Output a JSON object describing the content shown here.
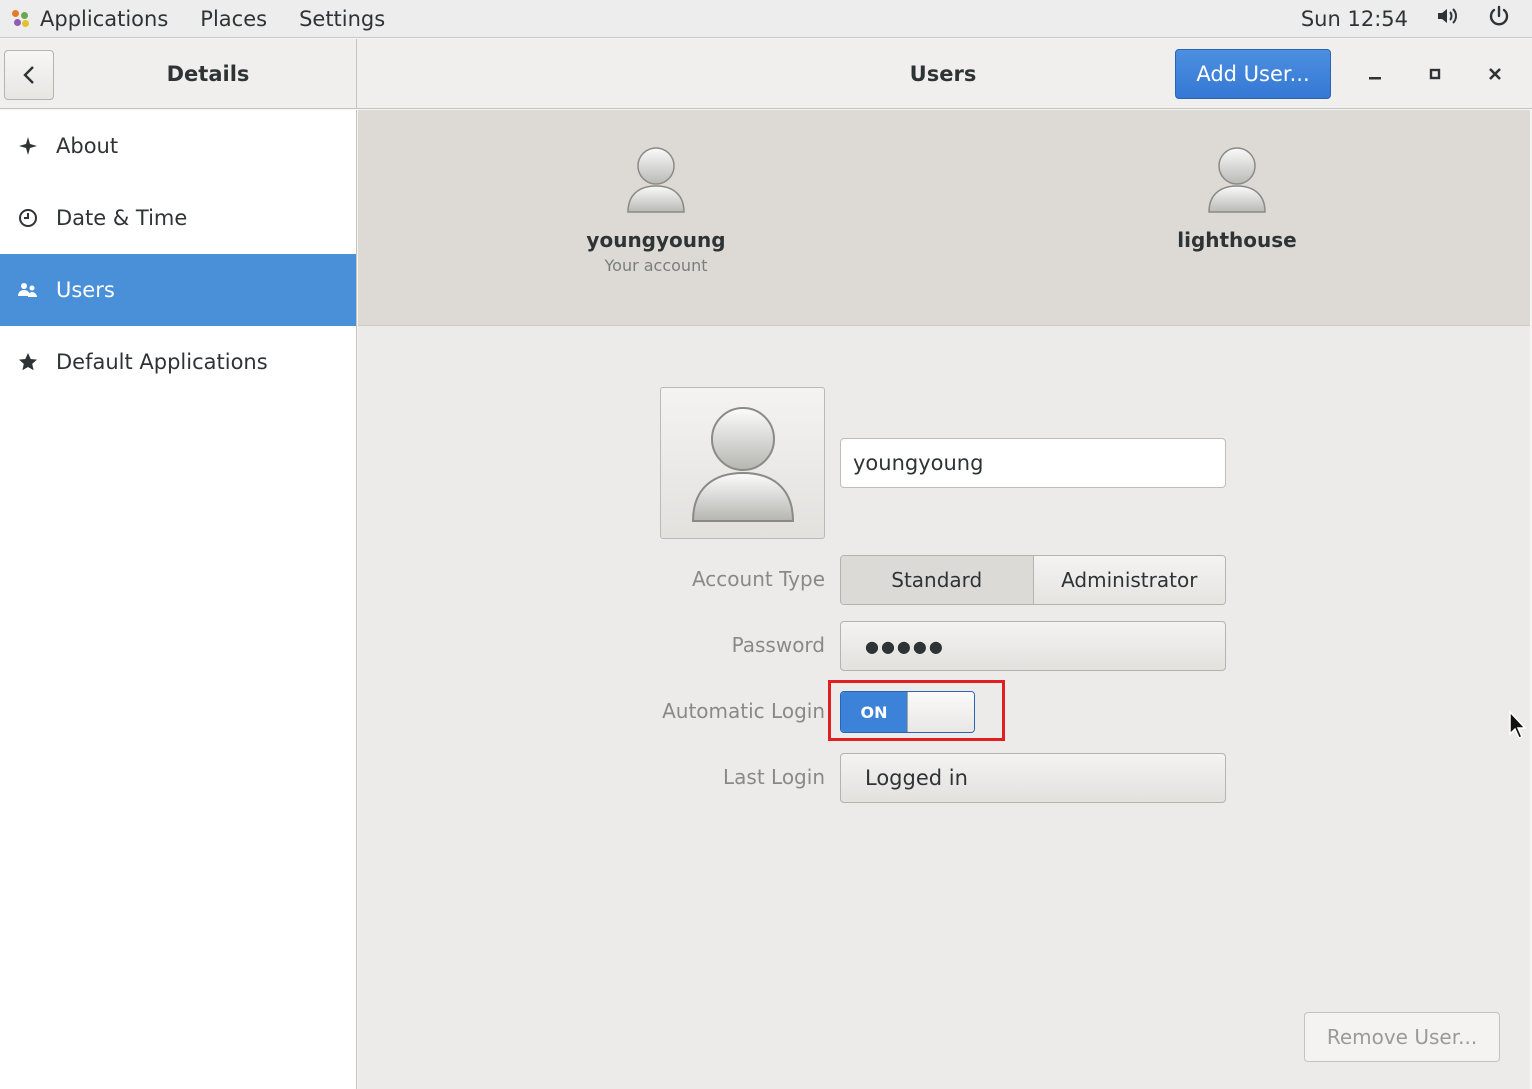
{
  "topbar": {
    "applications": "Applications",
    "places": "Places",
    "settings": "Settings",
    "clock": "Sun 12:54",
    "volume_icon": "volume-icon",
    "power_icon": "power-icon"
  },
  "header": {
    "left_title": "Details",
    "main_title": "Users",
    "add_user_label": "Add User..."
  },
  "sidebar": {
    "items": [
      {
        "label": "About",
        "icon": "sparkle-icon"
      },
      {
        "label": "Date & Time",
        "icon": "clock-icon"
      },
      {
        "label": "Users",
        "icon": "users-icon",
        "active": true
      },
      {
        "label": "Default Applications",
        "icon": "star-icon"
      }
    ]
  },
  "carousel": {
    "users": [
      {
        "name": "youngyoung",
        "subtitle": "Your account"
      },
      {
        "name": "lighthouse",
        "subtitle": ""
      }
    ]
  },
  "user_detail": {
    "full_name": "youngyoung",
    "account_type_label": "Account Type",
    "account_type_options": [
      "Standard",
      "Administrator"
    ],
    "account_type_selected": "Standard",
    "password_label": "Password",
    "password_value": "●●●●●",
    "auto_login_label": "Automatic Login",
    "auto_login_state": "ON",
    "last_login_label": "Last Login",
    "last_login_value": "Logged in",
    "remove_user_label": "Remove User..."
  },
  "colors": {
    "accent": "#4a90d9",
    "highlight_box": "#e02020"
  }
}
